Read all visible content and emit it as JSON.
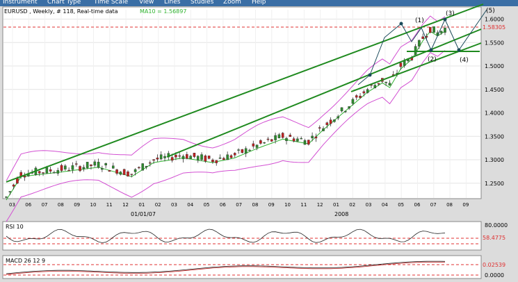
{
  "menu": [
    "Instrument",
    "Chart Type",
    "Time Scale",
    "View",
    "Lines",
    "Studies",
    "Zoom",
    "Help"
  ],
  "main_panel": {
    "header": "EURUSD , Weekly, # 118, Real-time data",
    "ma_label": "MA10 = 1.56897",
    "last_price": "1.58305",
    "y_ticks": [
      "1.6000",
      "1.5500",
      "1.5000",
      "1.4500",
      "1.4000",
      "1.3500",
      "1.3000",
      "1.2500"
    ],
    "x_months": [
      "03",
      "06",
      "07",
      "08",
      "09",
      "10",
      "11",
      "12",
      "01",
      "02",
      "03",
      "04",
      "05",
      "06",
      "07",
      "08",
      "09",
      "10",
      "11",
      "12",
      "01",
      "02",
      "03",
      "04",
      "05",
      "06",
      "07",
      "08",
      "09"
    ],
    "year_labels": [
      "01/01/07",
      "2008"
    ],
    "wave_labels": [
      "(1)",
      "(2)",
      "(3)",
      "(4)",
      "(5)"
    ]
  },
  "rsi_panel": {
    "title": "RSI 10",
    "level_top": "80.0000",
    "current": "58.4775"
  },
  "macd_panel": {
    "title": "MACD 26 12 9",
    "current": "0.02539",
    "zero": "0.0000"
  },
  "colors": {
    "menubar": "#3a6ea5",
    "channel": "#1f8a1f",
    "bollinger": "#d24fd2",
    "ma": "#2fb32f",
    "candle_up": "#2e8b2e",
    "candle_down": "#c02020",
    "dashed": "#e03030",
    "arrow": "#1a4a5a"
  },
  "chart_data": {
    "type": "candlestick",
    "title": "EURUSD , Weekly",
    "ylim": [
      1.22,
      1.62
    ],
    "last_price": 1.58305,
    "ma10": 1.56897,
    "rsi_current": 58.4775,
    "macd_current": 0.02539
  }
}
